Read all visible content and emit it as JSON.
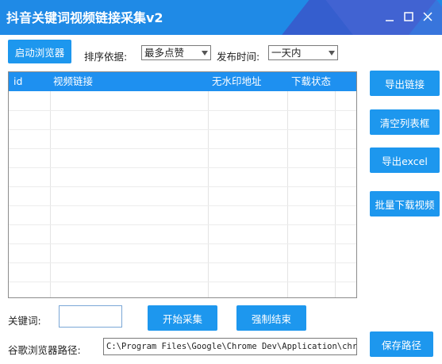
{
  "window": {
    "title": "抖音关键词视频链接采集v2"
  },
  "toolbar": {
    "launch_browser": "启动浏览器",
    "sort_label": "排序依据:",
    "sort_value": "最多点赞",
    "time_label": "发布时间:",
    "time_value": "一天内"
  },
  "table": {
    "columns": [
      "id",
      "视频链接",
      "无水印地址",
      "下载状态"
    ]
  },
  "side_buttons": {
    "export_links": "导出链接",
    "clear_list": "清空列表框",
    "export_excel": "导出excel",
    "batch_download": "批量下载视频",
    "save_path": "保存路径"
  },
  "bottom": {
    "keyword_label": "关键词:",
    "keyword_value": "",
    "start": "开始采集",
    "force_stop": "强制结束",
    "path_label": "谷歌浏览器路径:",
    "path_value": "C:\\Program Files\\Google\\Chrome Dev\\Application\\chrome.exe"
  }
}
